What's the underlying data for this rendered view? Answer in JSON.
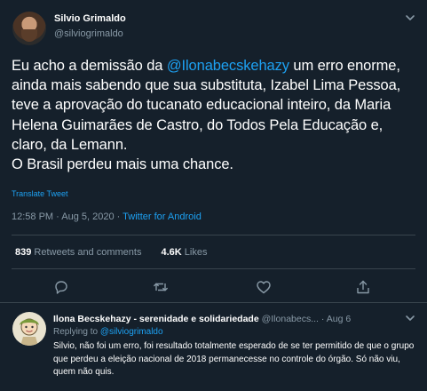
{
  "tweet": {
    "author_name": "Silvio Grimaldo",
    "author_handle": "@silviogrimaldo",
    "text_before_mention": "Eu acho a demissão da ",
    "mention": "@Ilonabecskehazy",
    "text_after_mention": " um erro enorme, ainda mais sabendo que sua substituta, Izabel Lima Pessoa, teve a aprovação do tucanato educacional inteiro, da Maria Helena Guimarães de Castro, do Todos Pela Educação e, claro, da Lemann.",
    "text_line_last": "O Brasil perdeu mais uma chance.",
    "translate_label": "Translate Tweet",
    "time": "12:58 PM · Aug 5, 2020 · ",
    "source": "Twitter for Android",
    "retweets_count": "839",
    "retweets_label": " Retweets and comments",
    "likes_count": "4.6K",
    "likes_label": " Likes"
  },
  "icons": {
    "more": "chevron-down-icon",
    "reply": "reply-icon",
    "retweet": "retweet-icon",
    "like": "heart-icon",
    "share": "share-icon"
  },
  "reply": {
    "author_name": "Ilona Becskehazy - serenidade e solidariedade",
    "author_handle": "@Ilonabecs...",
    "date": "Aug 6",
    "replying_label": "Replying to ",
    "replying_to": "@silviogrimaldo",
    "text": "Silvio, não foi um erro, foi resultado totalmente esperado de se ter permitido de que o grupo que perdeu a eleição nacional de 2018 permanecesse no controle do órgão. Só não viu, quem não quis."
  },
  "colors": {
    "background": "#15202b",
    "accent": "#1da1f2",
    "muted": "#8899a6",
    "divider": "#38444d"
  }
}
